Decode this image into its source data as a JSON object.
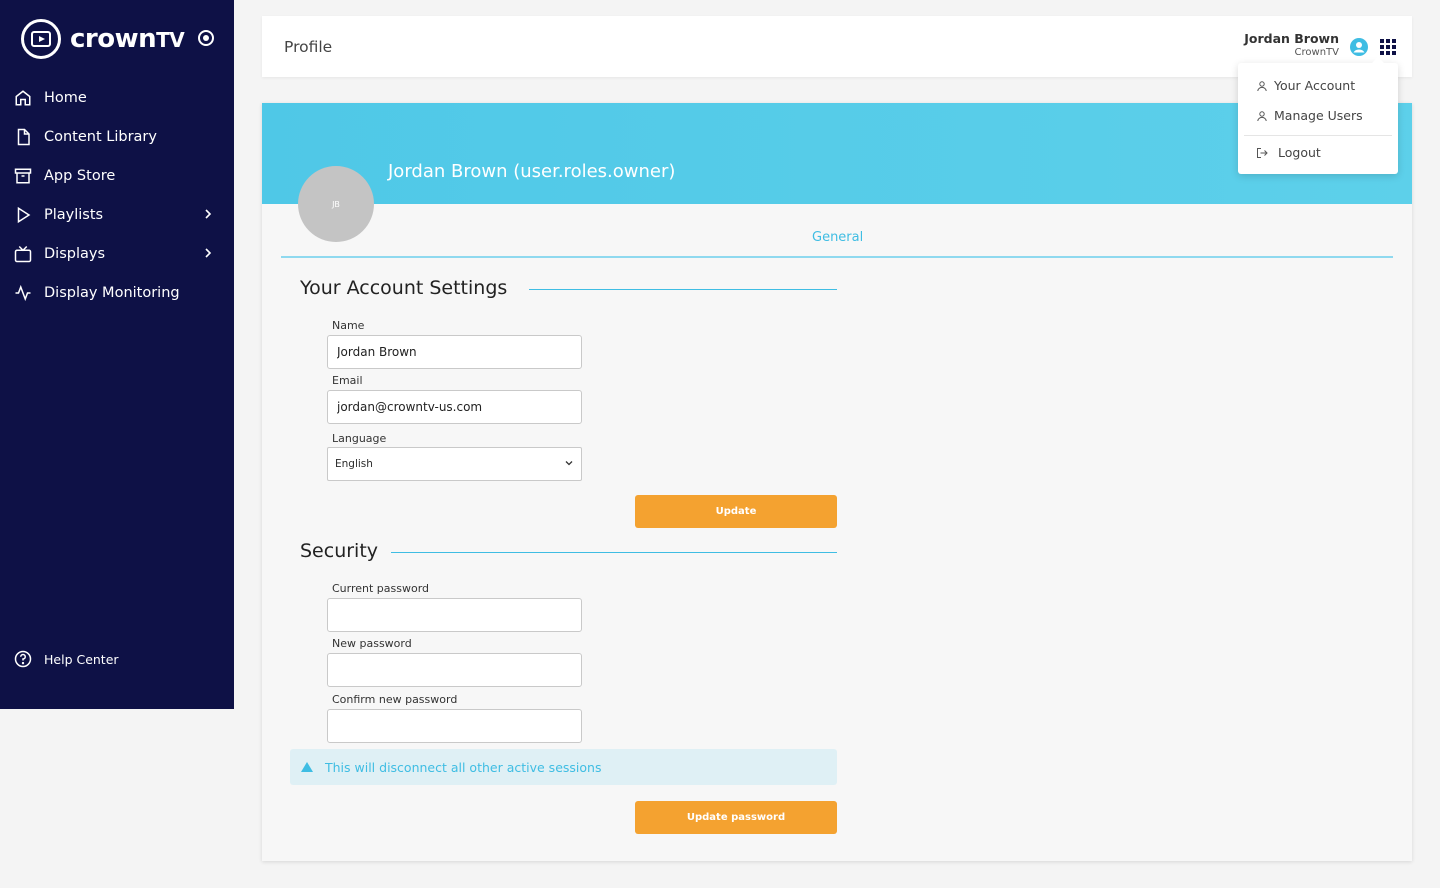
{
  "app": {
    "name_main": "crown",
    "name_suffix": "TV"
  },
  "sidebar": {
    "items": [
      {
        "label": "Home",
        "icon": "home-icon"
      },
      {
        "label": "Content Library",
        "icon": "file-icon"
      },
      {
        "label": "App Store",
        "icon": "archive-icon"
      },
      {
        "label": "Playlists",
        "icon": "play-icon",
        "expandable": true
      },
      {
        "label": "Displays",
        "icon": "tv-icon",
        "expandable": true
      },
      {
        "label": "Display Monitoring",
        "icon": "activity-icon"
      }
    ],
    "help": "Help Center"
  },
  "header": {
    "title": "Profile",
    "user_name": "Jordan Brown",
    "user_org": "CrownTV"
  },
  "user_menu": {
    "items": [
      "Your Account",
      "Manage Users",
      "Logout"
    ]
  },
  "profile": {
    "display_name": "Jordan Brown (user.roles.owner)",
    "initials": "JB",
    "tab": "General"
  },
  "account_settings": {
    "title": "Your Account Settings",
    "name_label": "Name",
    "name_value": "Jordan Brown",
    "email_label": "Email",
    "email_value": "jordan@crowntv-us.com",
    "language_label": "Language",
    "language_value": "English",
    "update_button": "Update"
  },
  "security": {
    "title": "Security",
    "current_label": "Current password",
    "new_label": "New password",
    "confirm_label": "Confirm new password",
    "alert": "This will disconnect all other active sessions",
    "update_button": "Update password"
  },
  "colors": {
    "sidebar_bg": "#0e1146",
    "accent": "#3fbde3",
    "button": "#f4a230"
  }
}
